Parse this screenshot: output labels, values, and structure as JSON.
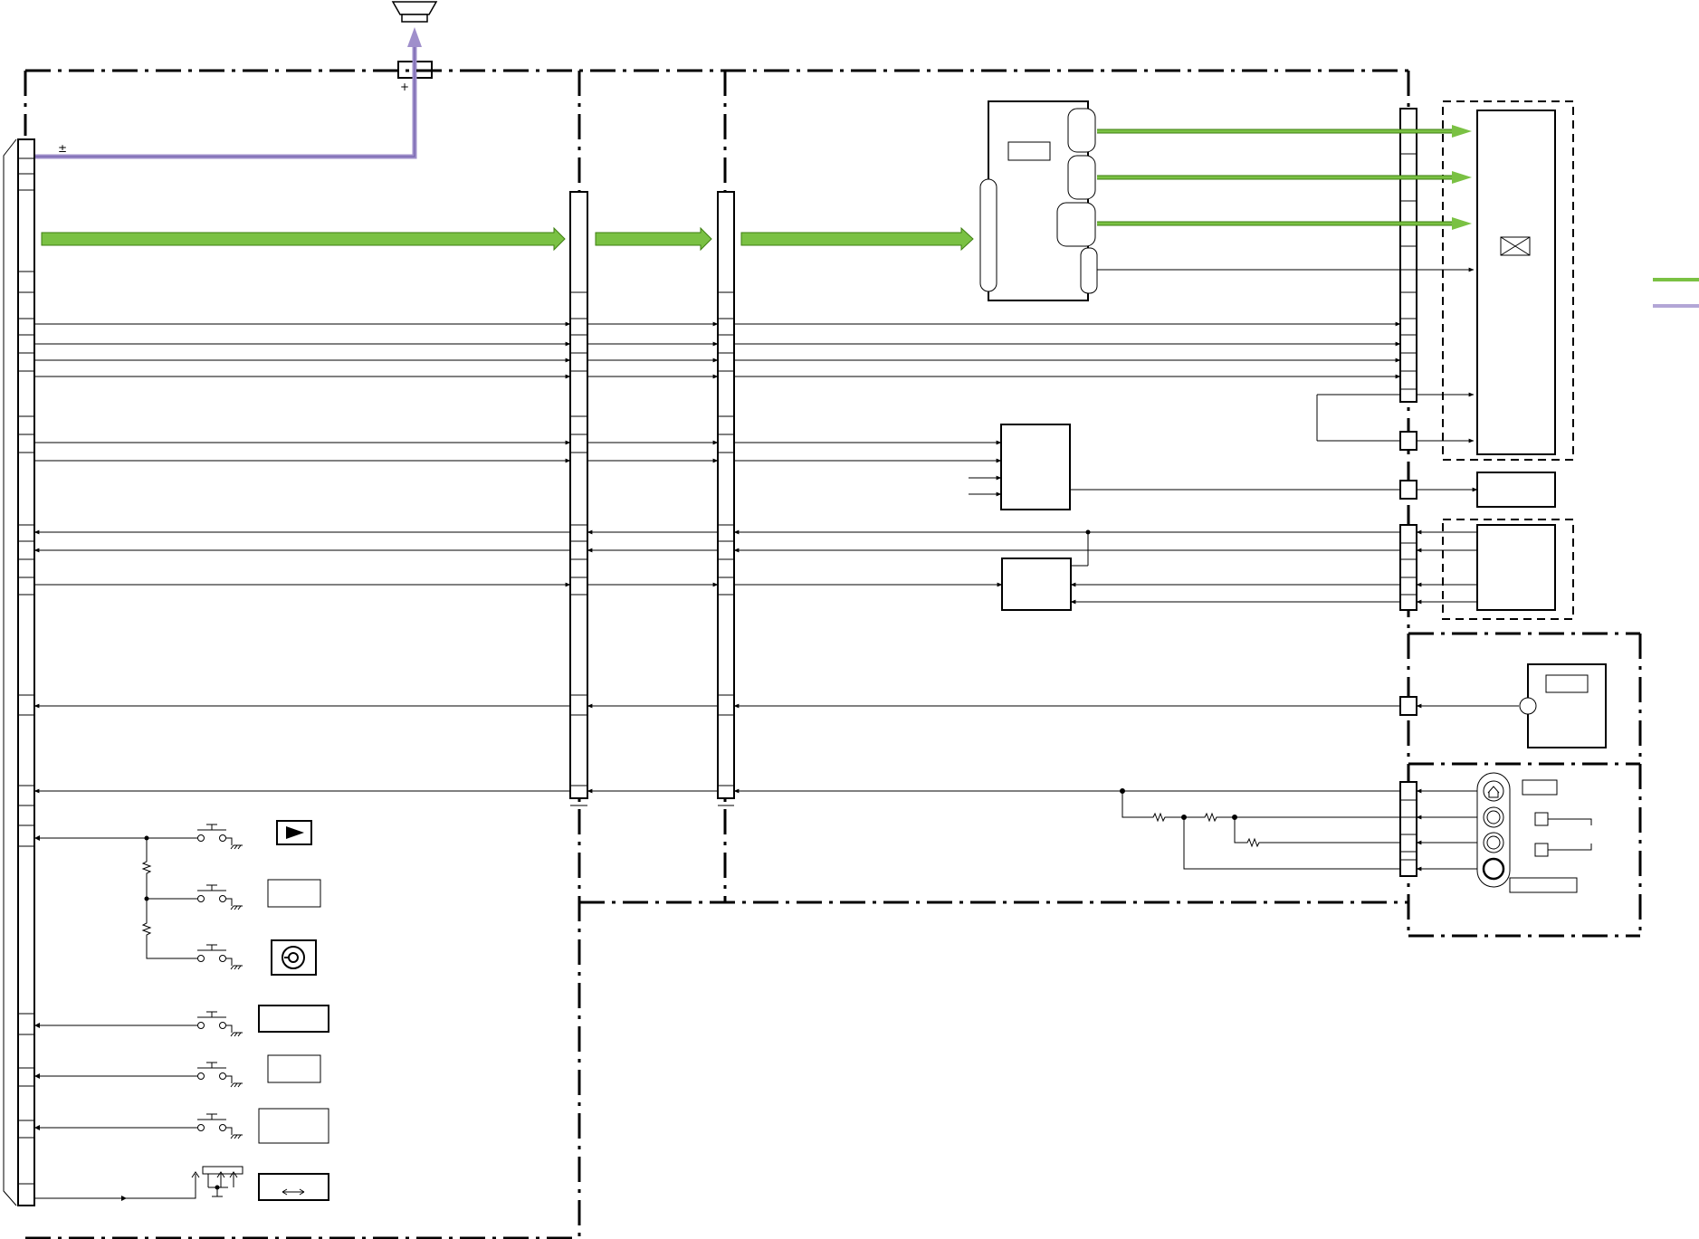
{
  "marks": {
    "speaker_plus": "+",
    "connector_plus_minus": "±"
  },
  "legend": {
    "video_color": "#7ac143",
    "audio_color": "#b3a6d6"
  },
  "colors": {
    "video_bus": "#7ac143",
    "video_bus_dark": "#3e7e12",
    "audio_bus": "#9f8fcb",
    "line": "#000000"
  },
  "icons": [
    "speaker-icon",
    "play-icon",
    "capture-icon",
    "arrows-icon",
    "envelope-icon",
    "home-icon"
  ]
}
